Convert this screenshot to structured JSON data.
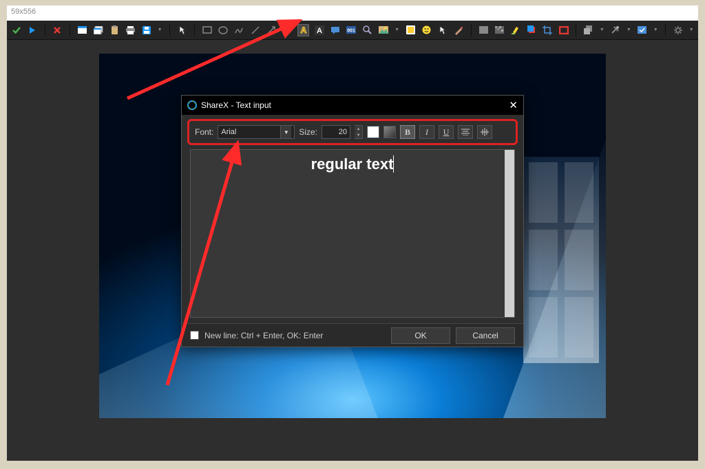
{
  "title_strip": "59x556",
  "toolbar_icons": [
    "confirm-icon",
    "play-icon",
    "cancel-icon",
    "window-icon",
    "windows-icon",
    "clipboard-icon",
    "print-icon",
    "save-icon",
    "cursor-icon",
    "rect-icon",
    "ellipse-icon",
    "freehand-icon",
    "line-icon",
    "arrow-icon",
    "arrow2-icon",
    "text-outline-icon",
    "text-bg-icon",
    "speech-icon",
    "step-icon",
    "magnify-icon",
    "image-icon",
    "sticker-icon",
    "emoji-icon",
    "cursor2-icon",
    "stamp-icon",
    "blur-icon",
    "pixelate-icon",
    "highlight-icon",
    "color-icon",
    "crop-icon",
    "redrect-icon",
    "duplicate-icon",
    "tools-icon",
    "actions-icon",
    "settings-icon"
  ],
  "dialog": {
    "title": "ShareX - Text input",
    "font_label": "Font:",
    "font_value": "Arial",
    "size_label": "Size:",
    "size_value": "20",
    "sample_text": "regular text",
    "hint": "New line: Ctrl + Enter, OK: Enter",
    "ok": "OK",
    "cancel": "Cancel"
  }
}
